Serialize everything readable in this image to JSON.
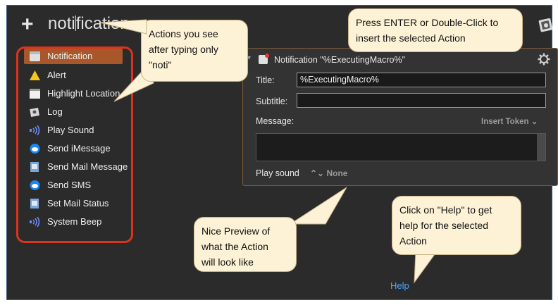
{
  "search": {
    "plus": "+",
    "typed": "noti",
    "rest": "fication"
  },
  "actions": [
    {
      "label": "Notification",
      "icon": "notification-icon",
      "selected": true
    },
    {
      "label": "Alert",
      "icon": "alert-icon"
    },
    {
      "label": "Highlight Location",
      "icon": "highlight-location-icon"
    },
    {
      "label": "Log",
      "icon": "log-icon"
    },
    {
      "label": "Play Sound",
      "icon": "speaker-icon"
    },
    {
      "label": "Send iMessage",
      "icon": "imessage-icon"
    },
    {
      "label": "Send Mail Message",
      "icon": "mail-icon"
    },
    {
      "label": "Send SMS",
      "icon": "imessage-icon"
    },
    {
      "label": "Set Mail Status",
      "icon": "mail-icon"
    },
    {
      "label": "System Beep",
      "icon": "speaker-icon"
    }
  ],
  "preview": {
    "title": "Notification \"%ExecutingMacro%\"",
    "title_label": "Title:",
    "title_value": "%ExecutingMacro%",
    "subtitle_label": "Subtitle:",
    "subtitle_value": "",
    "message_label": "Message:",
    "insert_token": "Insert Token ⌄",
    "play_sound_label": "Play sound",
    "play_sound_value": "⌃⌄ None"
  },
  "help": "Help",
  "callouts": {
    "actions": [
      "Actions you see",
      "after typing only",
      "\"noti\""
    ],
    "enter": [
      "Press ENTER or Double-Click to",
      "insert the selected Action"
    ],
    "preview": [
      "Nice Preview of",
      "what the Action",
      "will look like"
    ],
    "help": [
      "Click on \"Help\" to get",
      "help for the selected",
      "Action"
    ]
  },
  "colors": {
    "background": "#2b2b2b",
    "selection": "#a8572a",
    "highlight_border": "#e0321b",
    "callout": "#fdf2d6",
    "link": "#4ea3ff"
  }
}
